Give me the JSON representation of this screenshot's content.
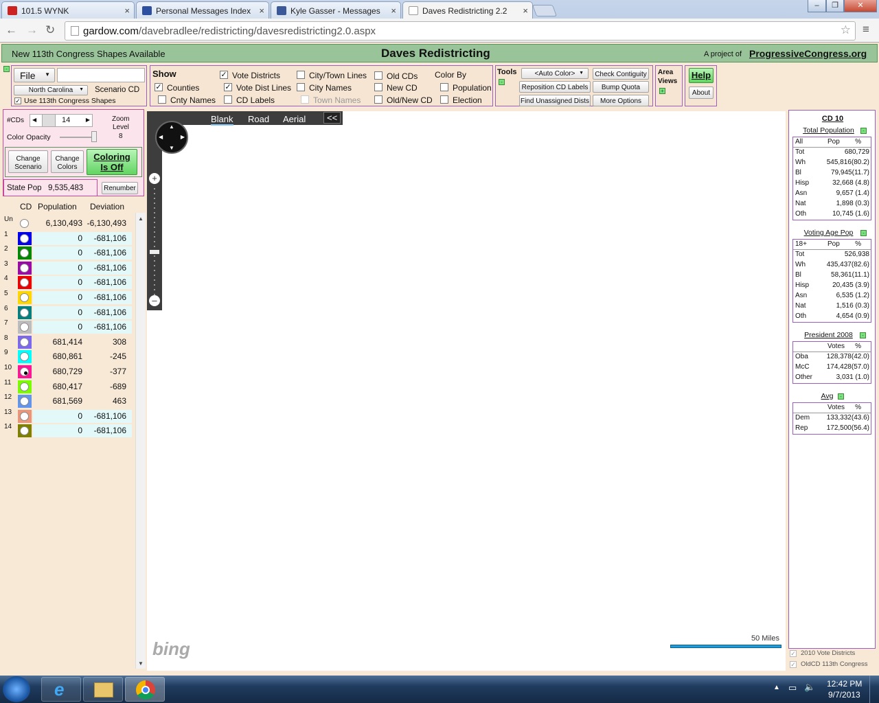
{
  "browser": {
    "tabs": [
      {
        "title": "101.5 WYNK",
        "color": "#cc2222"
      },
      {
        "title": "Personal Messages Index",
        "color": "#2c4fa0"
      },
      {
        "title": "Kyle Gasser - Messages",
        "color": "#3b5998"
      },
      {
        "title": "Daves Redistricting 2.2",
        "color": "#ffffff"
      }
    ],
    "url_domain": "gardow.com",
    "url_path": "/davebradlee/redistricting/davesredistricting2.0.aspx"
  },
  "banner": {
    "left": "New 113th Congress Shapes Available",
    "title": "Daves Redistricting",
    "project_prefix": "A project of",
    "project_link": "ProgressiveCongress.org"
  },
  "file_panel": {
    "file_label": "File",
    "state": "North Carolina",
    "scenario": "Scenario CD",
    "use_shapes": "Use 113th Congress Shapes"
  },
  "show_panel": {
    "title": "Show",
    "counties": "Counties",
    "cnty_names": "Cnty Names",
    "vote_districts": "Vote Districts",
    "vote_dist_lines": "Vote Dist Lines",
    "cd_labels": "CD Labels",
    "city_town_lines": "City/Town Lines",
    "city_names": "City Names",
    "town_names": "Town Names",
    "old_cds": "Old CDs",
    "new_cd": "New CD",
    "old_new_cd": "Old/New CD",
    "color_by": "Color By",
    "population": "Population",
    "election": "Election"
  },
  "tools_panel": {
    "title": "Tools",
    "auto_color": "<Auto Color>",
    "reposition": "Reposition CD Labels",
    "find_unassigned": "Find Unassigned Dists",
    "check_contiguity": "Check Contiguity",
    "bump_quota": "Bump Quota",
    "more_options": "More Options"
  },
  "area_views": {
    "title_line1": "Area",
    "title_line2": "Views"
  },
  "help": {
    "help": "Help",
    "about": "About"
  },
  "cd_controls": {
    "cds_label": "#CDs",
    "cds_value": "14",
    "opacity_label": "Color Opacity",
    "zoom_label_1": "Zoom",
    "zoom_label_2": "Level",
    "zoom_value": "8",
    "change_scenario": "Change Scenario",
    "change_colors": "Change Colors",
    "coloring": "Coloring Is Off",
    "state_pop_label": "State Pop",
    "state_pop": "9,535,483",
    "renumber": "Renumber"
  },
  "cd_table": {
    "headers": [
      "CD",
      "Population",
      "Deviation"
    ],
    "rows": [
      {
        "cd": "Un",
        "color": "#f8e9d7",
        "population": "6,130,493",
        "deviation": "-6,130,493",
        "row_bg": "#f8e9d7"
      },
      {
        "cd": "1",
        "color": "#0000ee",
        "population": "0",
        "deviation": "-681,106",
        "row_bg": "#e3f8f8"
      },
      {
        "cd": "2",
        "color": "#008800",
        "population": "0",
        "deviation": "-681,106",
        "row_bg": "#e3f8f8"
      },
      {
        "cd": "3",
        "color": "#9a0aa6",
        "population": "0",
        "deviation": "-681,106",
        "row_bg": "#e3f8f8"
      },
      {
        "cd": "4",
        "color": "#ee0000",
        "population": "0",
        "deviation": "-681,106",
        "row_bg": "#e3f8f8"
      },
      {
        "cd": "5",
        "color": "#ffd700",
        "population": "0",
        "deviation": "-681,106",
        "row_bg": "#e3f8f8"
      },
      {
        "cd": "6",
        "color": "#008080",
        "population": "0",
        "deviation": "-681,106",
        "row_bg": "#e3f8f8"
      },
      {
        "cd": "7",
        "color": "#bdbdbd",
        "population": "0",
        "deviation": "-681,106",
        "row_bg": "#e3f8f8"
      },
      {
        "cd": "8",
        "color": "#7b68ee",
        "population": "681,414",
        "deviation": "308",
        "row_bg": "#f8e9d7"
      },
      {
        "cd": "9",
        "color": "#00ffff",
        "population": "680,861",
        "deviation": "-245",
        "row_bg": "#f8e9d7"
      },
      {
        "cd": "10",
        "color": "#ff1493",
        "population": "680,729",
        "deviation": "-377",
        "row_bg": "#f8e9d7"
      },
      {
        "cd": "11",
        "color": "#7cfc00",
        "population": "680,417",
        "deviation": "-689",
        "row_bg": "#f8e9d7"
      },
      {
        "cd": "12",
        "color": "#6495ed",
        "population": "681,569",
        "deviation": "463",
        "row_bg": "#f8e9d7"
      },
      {
        "cd": "13",
        "color": "#e9967a",
        "population": "0",
        "deviation": "-681,106",
        "row_bg": "#e3f8f8"
      },
      {
        "cd": "14",
        "color": "#808000",
        "population": "0",
        "deviation": "-681,106",
        "row_bg": "#e3f8f8"
      }
    ]
  },
  "map": {
    "tabs": [
      "Blank",
      "Road",
      "Aerial",
      "<<"
    ],
    "scale": "50 Miles",
    "logo": "bing",
    "district_colors": {
      "d11": "#7cfc00",
      "d10": "#ff1493",
      "d9": "#00ffff",
      "d8": "#6a5acd",
      "d12": "#6495ed",
      "un": "#ffffff"
    }
  },
  "stats": {
    "cd_title": "CD 10",
    "total_pop_title": "Total Population",
    "total_pop": {
      "headers": [
        "All",
        "Pop",
        "%"
      ],
      "rows": [
        [
          "Tot",
          "680,729"
        ],
        [
          "Wh",
          "545,816(80.2)"
        ],
        [
          "Bl",
          "79,945(11.7)"
        ],
        [
          "Hisp",
          "32,668 (4.8)"
        ],
        [
          "Asn",
          "9,657 (1.4)"
        ],
        [
          "Nat",
          "1,898 (0.3)"
        ],
        [
          "Oth",
          "10,745 (1.6)"
        ]
      ]
    },
    "vap_title": "Voting Age Pop",
    "vap": {
      "headers": [
        "18+",
        "Pop",
        "%"
      ],
      "rows": [
        [
          "Tot",
          "526,938"
        ],
        [
          "Wh",
          "435,437(82.6)"
        ],
        [
          "Bl",
          "58,361(11.1)"
        ],
        [
          "Hisp",
          "20,435 (3.9)"
        ],
        [
          "Asn",
          "6,535 (1.2)"
        ],
        [
          "Nat",
          "1,516 (0.3)"
        ],
        [
          "Oth",
          "4,654 (0.9)"
        ]
      ]
    },
    "pres_title": "President 2008",
    "pres": {
      "headers": [
        "",
        "Votes",
        "%"
      ],
      "rows": [
        [
          "Oba",
          "128,378(42.0)"
        ],
        [
          "McC",
          "174,428(57.0)"
        ],
        [
          "Other",
          "3,031 (1.0)"
        ]
      ]
    },
    "avg_title": "Avg",
    "avg": {
      "headers": [
        "",
        "Votes",
        "%"
      ],
      "rows": [
        [
          "Dem",
          "133,332(43.6)"
        ],
        [
          "Rep",
          "172,500(56.4)"
        ]
      ]
    },
    "legend_2010": "2010 Vote Districts",
    "legend_oldcd": "OldCD 113th Congress"
  },
  "taskbar": {
    "time": "12:42 PM",
    "date": "9/7/2013"
  }
}
